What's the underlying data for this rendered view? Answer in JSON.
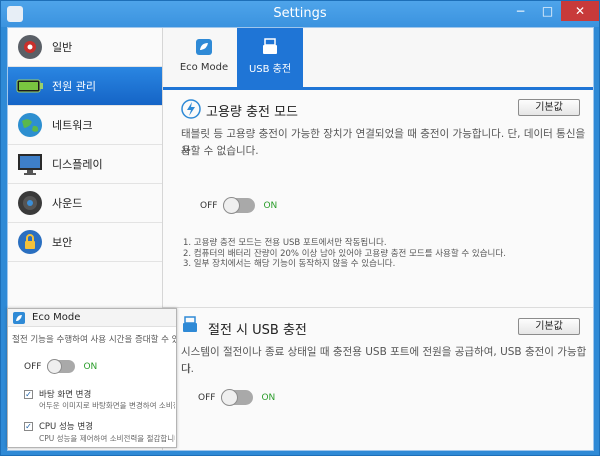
{
  "window": {
    "title": "Settings",
    "controls": {
      "minimize": "−",
      "maximize": "□",
      "close": "✕"
    },
    "accent_color": "#1f75d6"
  },
  "sidebar": {
    "items": [
      {
        "label": "일반",
        "icon": "settings-gear-icon",
        "active": false
      },
      {
        "label": "전원 관리",
        "icon": "battery-icon",
        "active": true
      },
      {
        "label": "네트워크",
        "icon": "globe-icon",
        "active": false
      },
      {
        "label": "디스플레이",
        "icon": "monitor-icon",
        "active": false
      },
      {
        "label": "사운드",
        "icon": "speaker-icon",
        "active": false
      },
      {
        "label": "보안",
        "icon": "lock-icon",
        "active": false
      }
    ]
  },
  "tabs": [
    {
      "label": "Eco Mode",
      "icon": "leaf-icon",
      "active": false
    },
    {
      "label": "USB 충전",
      "icon": "usb-icon",
      "active": true
    }
  ],
  "high_current_charge": {
    "title": "고용량 충전 모드",
    "default_button": "기본값",
    "description_line1": "태블릿 등 고용량 충전이 가능한 장치가 연결되었을 때 충전이 가능합니다. 단, 데이터 통신을 사",
    "description_line2": "용할 수 없습니다.",
    "toggle": {
      "off_label": "OFF",
      "on_label": "ON",
      "state": "off"
    },
    "notes": [
      "1. 고용량 충전 모드는 전용 USB 포트에서만 작동됩니다.",
      "2. 컴퓨터의 배터리 잔량이 20% 이상 남아 있어야 고용량 충전 모드를 사용할 수 있습니다.",
      "3. 일부 장치에서는 해당 기능이 동작하지 않을 수 있습니다."
    ]
  },
  "usb_charge_off": {
    "title": "절전 시 USB 충전",
    "default_button": "기본값",
    "description_line1": "시스템이 절전이나 종료 상태일 때 충전용 USB 포트에 전원을 공급하여, USB 충전이 가능합니",
    "description_line2": "다.",
    "toggle": {
      "off_label": "OFF",
      "on_label": "ON",
      "state": "off"
    }
  },
  "eco_popup": {
    "title": "Eco Mode",
    "description": "절전 기능을 수행하여 사용 시간을 증대할 수 있",
    "toggle": {
      "off_label": "OFF",
      "on_label": "ON",
      "state": "off"
    },
    "options": [
      {
        "title": "바탕 화면 변경",
        "desc": "어두운 이미지로 바탕화면을 변경하여 소비전력",
        "checked": true
      },
      {
        "title": "CPU 성능 변경",
        "desc": "CPU 성능을 제어하여 소비전력을 절감합니다.",
        "checked": true
      }
    ]
  }
}
